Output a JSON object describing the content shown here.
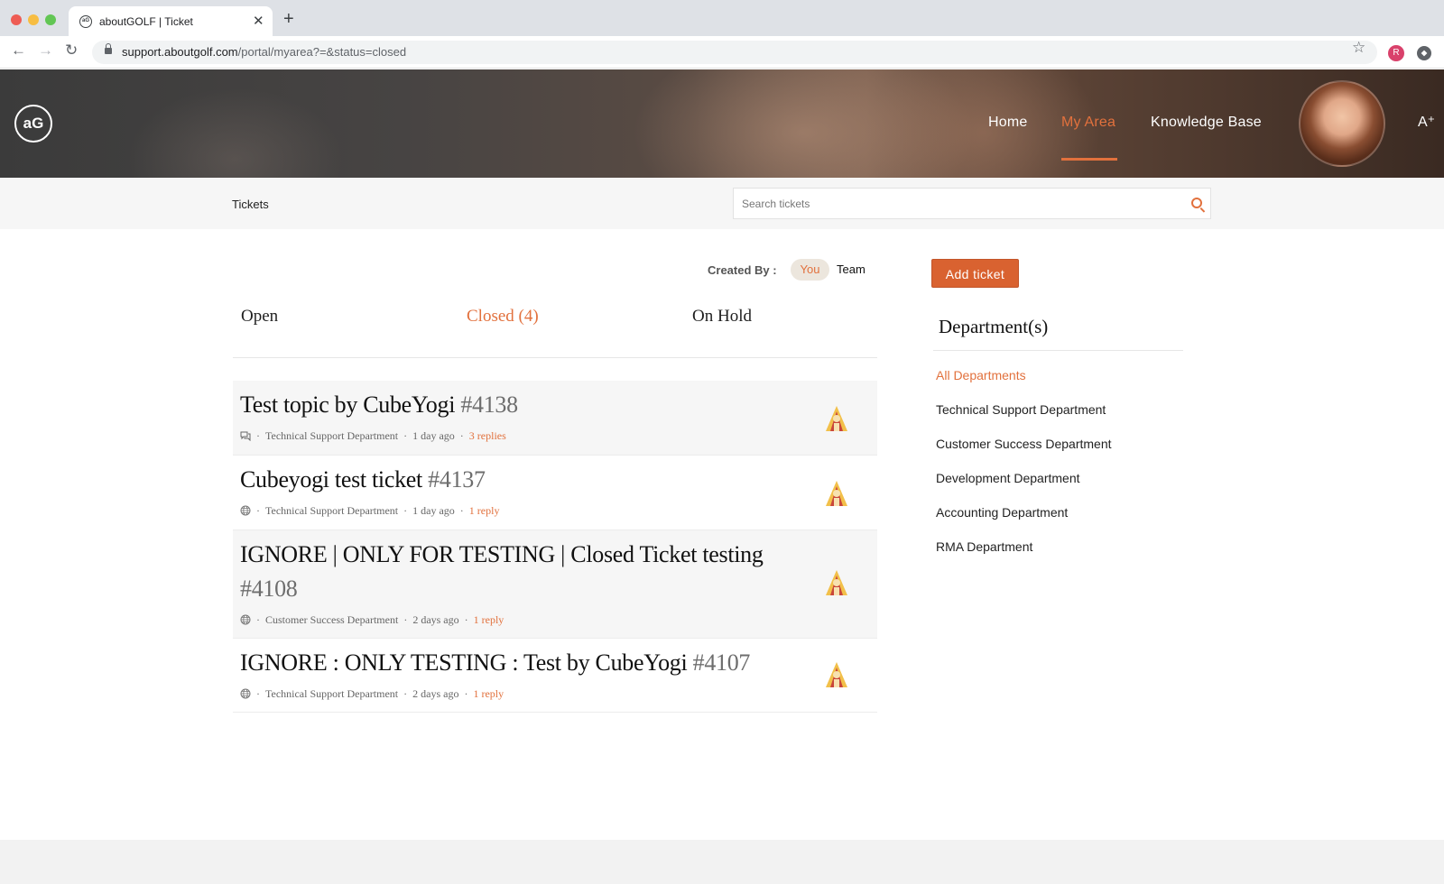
{
  "browser": {
    "tab_favicon_text": "aG",
    "tab_title": "aboutGOLF | Ticket",
    "tab_close": "✕",
    "new_tab": "+",
    "back": "←",
    "forward": "→",
    "reload": "↻",
    "url_domain": "support.aboutgolf.com",
    "url_path": "/portal/myarea?=&status=closed",
    "bookmark": "☆",
    "profile_initial": "R"
  },
  "header": {
    "logo_text": "aG",
    "nav": {
      "home": "Home",
      "my_area": "My Area",
      "knowledge_base": "Knowledge Base"
    },
    "font_toggle": "A⁺"
  },
  "subbar": {
    "title": "Tickets",
    "search_placeholder": "Search tickets"
  },
  "filters": {
    "created_by_label": "Created By :",
    "you": "You",
    "team": "Team"
  },
  "status_tabs": {
    "open": "Open",
    "closed": "Closed (4)",
    "on_hold": "On Hold"
  },
  "tickets": [
    {
      "title": "Test topic by CubeYogi",
      "number": "#4138",
      "department": "Technical Support Department",
      "time": "1 day ago",
      "replies": "3 replies",
      "channel_icon": "chat-icon"
    },
    {
      "title": "Cubeyogi test ticket",
      "number": "#4137",
      "department": "Technical Support Department",
      "time": "1 day ago",
      "replies": "1 reply",
      "channel_icon": "globe-icon"
    },
    {
      "title": "IGNORE | ONLY FOR TESTING | Closed Ticket testing",
      "number": "#4108",
      "department": "Customer Success Department",
      "time": "2 days ago",
      "replies": "1 reply",
      "channel_icon": "globe-icon"
    },
    {
      "title": "IGNORE : ONLY TESTING : Test by CubeYogi",
      "number": "#4107",
      "department": "Technical Support Department",
      "time": "2 days ago",
      "replies": "1 reply",
      "channel_icon": "globe-icon"
    }
  ],
  "meta_separator": "·",
  "sidebar": {
    "add_ticket": "Add ticket",
    "departments_heading": "Department(s)",
    "departments": [
      "All Departments",
      "Technical Support Department",
      "Customer Success Department",
      "Development Department",
      "Accounting Department",
      "RMA Department"
    ]
  },
  "colors": {
    "accent": "#e2713d",
    "button": "#d96230"
  }
}
